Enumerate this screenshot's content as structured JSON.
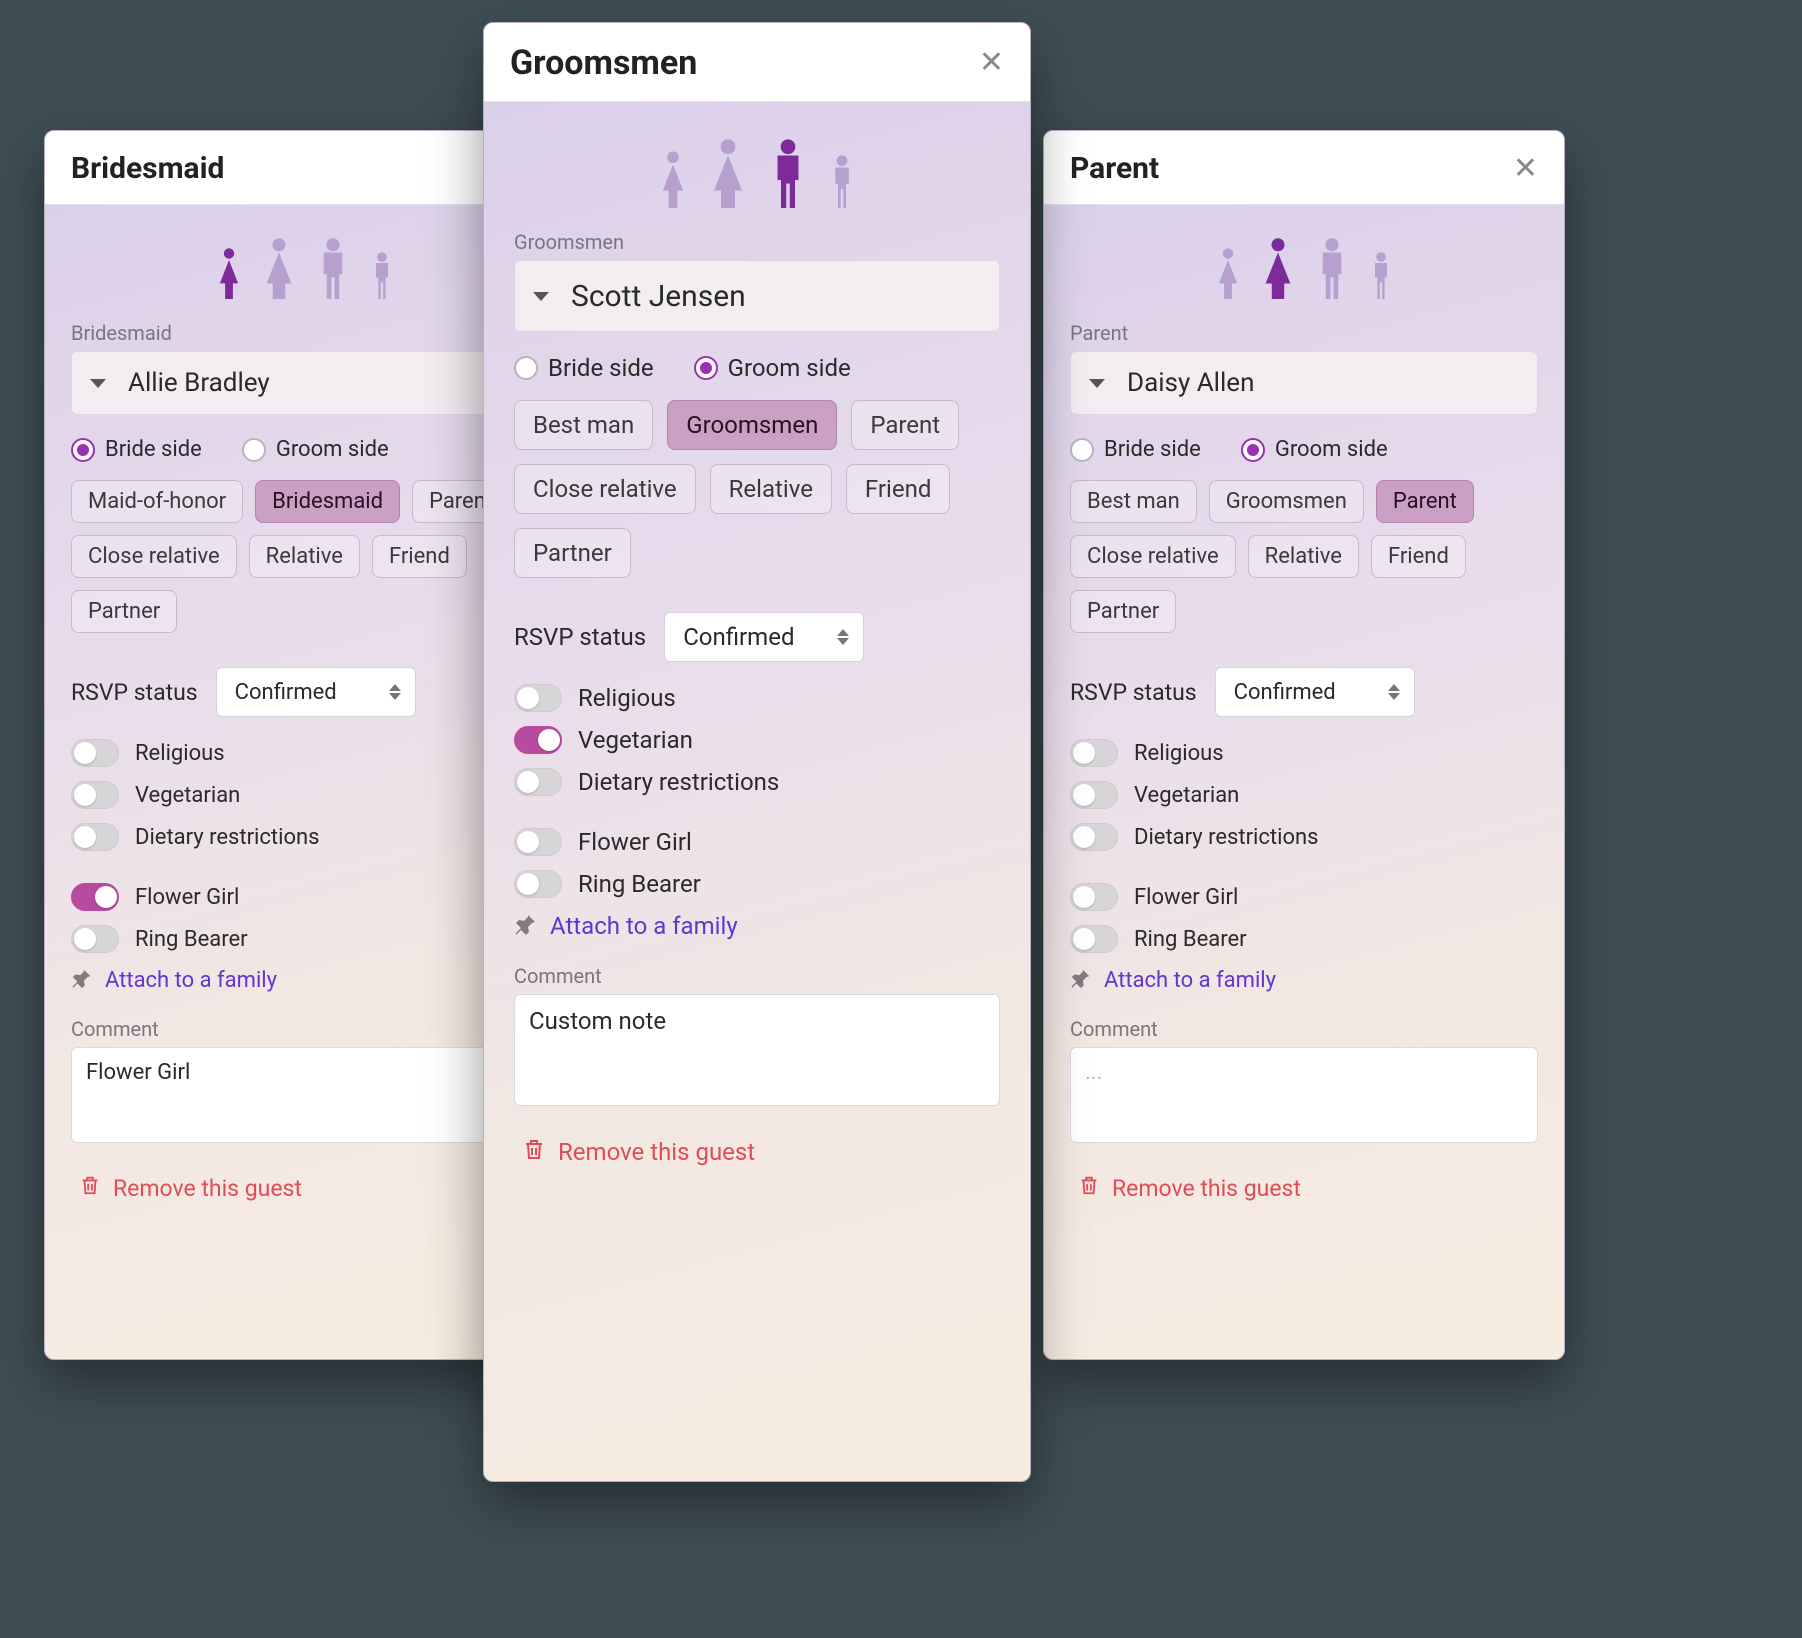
{
  "common": {
    "rsvp_label": "RSVP status",
    "rsvp_value": "Confirmed",
    "bride_side_label": "Bride side",
    "groom_side_label": "Groom side",
    "toggles": {
      "religious": "Religious",
      "vegetarian": "Vegetarian",
      "dietary": "Dietary restrictions",
      "flower_girl": "Flower Girl",
      "ring_bearer": "Ring Bearer"
    },
    "attach_label": "Attach to a family",
    "comment_label": "Comment",
    "remove_label": "Remove this guest",
    "comment_placeholder": "..."
  },
  "roles_bride": [
    "Maid-of-honor",
    "Bridesmaid",
    "Parent",
    "Close relative",
    "Relative",
    "Friend",
    "Partner"
  ],
  "roles_groom": [
    "Best man",
    "Groomsmen",
    "Parent",
    "Close relative",
    "Relative",
    "Friend",
    "Partner"
  ],
  "cards": {
    "left": {
      "title": "Bridesmaid",
      "role_label": "Bridesmaid",
      "name": "Allie Bradley",
      "side_selected": "bride",
      "role_selected_index": 1,
      "show_bouquet": true,
      "toggles_on": {
        "flower_girl": true
      },
      "comment": "Flower Girl"
    },
    "center": {
      "title": "Groomsmen",
      "role_label": "Groomsmen",
      "name": "Scott Jensen",
      "side_selected": "groom",
      "role_selected_index": 1,
      "show_bouquet": false,
      "toggles_on": {
        "vegetarian": true
      },
      "comment": "Custom note"
    },
    "right": {
      "title": "Parent",
      "role_label": "Parent",
      "name": "Daisy Allen",
      "side_selected": "groom",
      "role_selected_index": 2,
      "show_bouquet": false,
      "toggles_on": {},
      "comment": ""
    }
  }
}
